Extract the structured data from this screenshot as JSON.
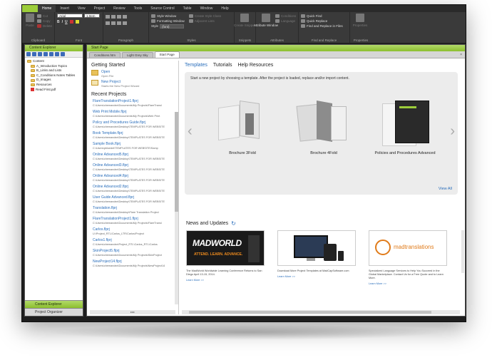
{
  "ribbon": {
    "tabs": [
      "Home",
      "Insert",
      "View",
      "Project",
      "Review",
      "Tools",
      "Source Control",
      "Table",
      "Window",
      "Help"
    ],
    "active_tab": "Home",
    "clipboard": {
      "paste": "Paste",
      "cut": "Cut",
      "copy": "Copy",
      "delete": "Delete",
      "label": "Clipboard"
    },
    "font": {
      "family": "Arial",
      "size": "1.0em",
      "label": "Font"
    },
    "paragraph": {
      "label": "Paragraph"
    },
    "styles": {
      "style_window": "Style Window",
      "formatting_window": "Formatting Window",
      "style_label": "Style",
      "style_value": "(font)",
      "create_style_class": "Create Style Class",
      "adjacent_lists": "Adjacent Lists",
      "label": "Styles"
    },
    "snippet": {
      "create_snippet": "Create Snippet",
      "label": "Snippets"
    },
    "attributes": {
      "attribute_window": "Attribute Window",
      "conditions": "Conditions",
      "language": "Language",
      "label": "Attributes"
    },
    "find": {
      "quick_find": "Quick Find",
      "quick_replace": "Quick Replace",
      "find_replace_files": "Find and Replace in Files",
      "label": "Find and Replace"
    },
    "properties": {
      "properties": "Properties",
      "label": "Properties"
    }
  },
  "left_panel": {
    "title": "Content Explorer",
    "tree": [
      {
        "label": "Content",
        "type": "folder"
      },
      {
        "label": "A_Introduction Topics",
        "type": "folder"
      },
      {
        "label": "B_Links and Lists",
        "type": "folder"
      },
      {
        "label": "C_Conditions Notes Tables",
        "type": "folder"
      },
      {
        "label": "D_Images",
        "type": "folder"
      },
      {
        "label": "Resources",
        "type": "folder"
      },
      {
        "label": "Read First.pdf",
        "type": "pdf"
      }
    ],
    "accordion": [
      {
        "label": "Content Explorer",
        "active": true
      },
      {
        "label": "Project Organizer",
        "active": false
      }
    ]
  },
  "main": {
    "title": "Start Page",
    "doc_tabs": [
      "Conditions.htm",
      "Light Grey Sky",
      "Start Page"
    ],
    "active_doc_tab": "Start Page",
    "close": "×",
    "getting_started": {
      "heading": "Getting Started",
      "open_label": "Open",
      "open_sub": "Open File",
      "new_label": "New Project",
      "new_sub": "Starts the New Project Wizard"
    },
    "recent": {
      "heading": "Recent Projects",
      "items": [
        {
          "name": "FlareTranslationProject1.flprj",
          "path": "C:\\Users\\chemandez\\Documents\\My Projects\\FlareTransl"
        },
        {
          "name": "Web Print Mobile.flprj",
          "path": "C:\\Users\\chemandez\\Documents\\My Projects\\Web Print"
        },
        {
          "name": "Policy and Procedures Guide.flprj",
          "path": "C:\\Users\\chemandez\\Desktop\\TEMPLATES FOR WEBSITE"
        },
        {
          "name": "Book Template.flprj",
          "path": "C:\\Users\\chemandez\\Desktop\\TEMPLATES FOR WEBSITE"
        },
        {
          "name": "Sample Book.flprj",
          "path": "C:\\Users\\pbloedel\\TEMPLATES FOR WEBSITE\\Samp"
        },
        {
          "name": "Online Advanced5.flprj",
          "path": "C:\\Users\\chemandez\\Desktop\\TEMPLATES FOR WEBSITE"
        },
        {
          "name": "Online Advanced3.flprj",
          "path": "C:\\Users\\chemandez\\Desktop\\TEMPLATES FOR WEBSITE"
        },
        {
          "name": "Online Advanced4.flprj",
          "path": "C:\\Users\\chemandez\\Desktop\\TEMPLATES FOR WEBSITE"
        },
        {
          "name": "Online Advanced2.flprj",
          "path": "C:\\Users\\chemandez\\Desktop\\TEMPLATES FOR WEBSITE"
        },
        {
          "name": "User Guide Advanced.flprj",
          "path": "C:\\Users\\chemandez\\Desktop\\TEMPLATES FOR WEBSITE"
        },
        {
          "name": "Translation.flprj",
          "path": "C:\\Users\\chemandez\\Desktop\\Flare Translation Project"
        },
        {
          "name": "FlareTranslationProject1.flprj",
          "path": "C:\\Users\\chemandez\\Documents\\My Projects\\FlareTransl"
        },
        {
          "name": "Carlos.flprj",
          "path": "U:\\Project_RTL\\Carlos_LTR\\Carlos\\Project"
        },
        {
          "name": "Carlos1.flprj",
          "path": "C:\\Users\\chemandez\\Project_RTL\\Carlos_RTL\\Carlos"
        },
        {
          "name": "SkinProject5.flprj",
          "path": "C:\\Users\\chemandez\\Documents\\My Projects\\SkinProject"
        },
        {
          "name": "NewProject14.flprj",
          "path": "C:\\Users\\chemandez\\Documents\\My Projects\\NewProject14"
        }
      ]
    },
    "resources": {
      "tabs": [
        "Templates",
        "Tutorials",
        "Help Resources"
      ],
      "active": "Templates",
      "intro": "Start a new project by choosing a template. After the project is loaded, replace and/or import content.",
      "templates": [
        "Brochure 3Fold",
        "Brochure 4Fold",
        "Policies and Procedures Advanced"
      ],
      "view_all": "View All",
      "prev": "‹",
      "next": "›"
    },
    "news": {
      "heading": "News and Updates",
      "refresh": "↻",
      "items": [
        {
          "text": "The MadWorld Worldwide Learning Conference Returns to San Diego April 13-15, 2014.",
          "link": "Learn More >>",
          "brand": "MADWORLD",
          "tagline": "ATTEND. LEARN. ADVANCE."
        },
        {
          "text": "Download More Project Templates at MadCapSoftware.com",
          "link": "Learn More >>"
        },
        {
          "text": "Specialized Language Services to Help You Succeed in the Global Marketplace. Contact Us for a Free Quote and to Learn More.",
          "link": "Learn More >>",
          "brand": "madtranslations"
        }
      ]
    }
  }
}
